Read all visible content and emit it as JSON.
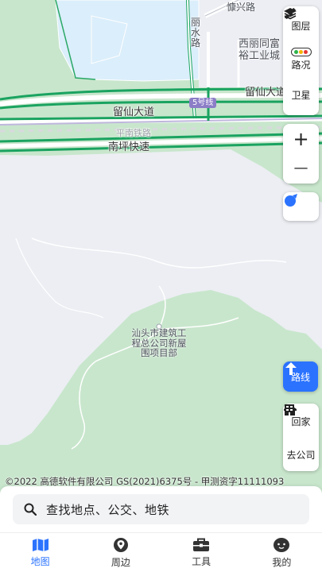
{
  "map": {
    "labels": {
      "kangxing_road": "慷兴路",
      "li_shui_road": "丽\n水\n路",
      "xili_industrial": "西丽同富\n裕工业城",
      "liuxian_ave_right": "留仙大道",
      "liuxian_ave": "留仙大道",
      "line5": "5号线",
      "pingnan_railway": "平南铁路",
      "nanping_expressway": "南坪快速",
      "poi": "汕头市建筑工\n程总公司新屋\n围项目部"
    },
    "copyright": "©2022 高德软件有限公司 GS(2021)6375号 - 甲测资字11111093"
  },
  "controls": {
    "layers_label": "图层",
    "traffic_label": "路况",
    "satellite_label": "卫星",
    "zoom_in": "+",
    "zoom_out": "—",
    "route_label": "路线",
    "home_label": "回家",
    "company_label": "去公司"
  },
  "search": {
    "placeholder": "查找地点、公交、地铁"
  },
  "nav": {
    "items": [
      {
        "label": "地图",
        "icon": "map-icon"
      },
      {
        "label": "周边",
        "icon": "nearby-icon"
      },
      {
        "label": "工具",
        "icon": "toolbox-icon"
      },
      {
        "label": "我的",
        "icon": "profile-icon"
      }
    ]
  },
  "colors": {
    "accent": "#2b73ff",
    "green_area": "#c8e6cc",
    "land": "#eceef3",
    "water": "#dbeefb",
    "road_green": "#1aa360"
  }
}
